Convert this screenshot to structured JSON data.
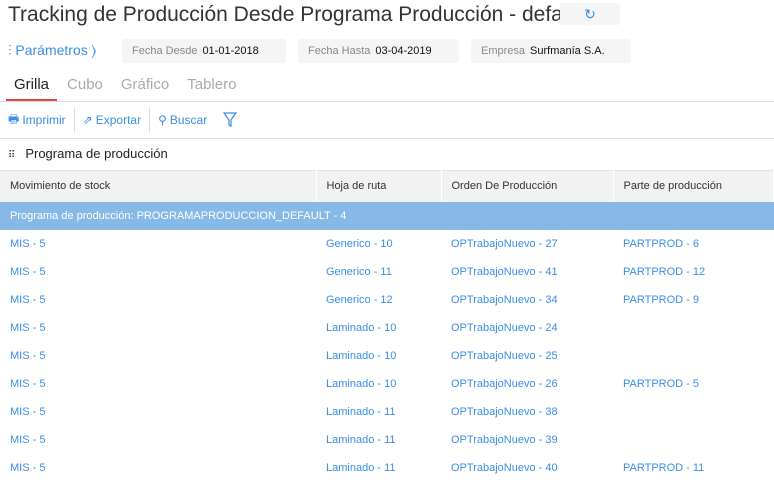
{
  "header": {
    "title": "Tracking de Producción Desde Programa Producción - default",
    "refresh_icon": "↻"
  },
  "params": {
    "label": "Parámetros ⟩",
    "filters": [
      {
        "label": "Fecha Desde",
        "value": "01-01-2018"
      },
      {
        "label": "Fecha Hasta",
        "value": "03-04-2019"
      },
      {
        "label": "Empresa",
        "value": "Surfmanía S.A."
      }
    ]
  },
  "tabs": [
    "Grilla",
    "Cubo",
    "Gráfico",
    "Tablero"
  ],
  "toolbar": {
    "print": "Imprimir",
    "export": "Exportar",
    "search": "Buscar"
  },
  "section": {
    "title": "Programa de producción"
  },
  "table": {
    "columns": [
      "Movimiento de stock",
      "Hoja de ruta",
      "Orden De Producción",
      "Parte de producción"
    ],
    "group": "Programa de producción: PROGRAMAPRODUCCION_DEFAULT - 4",
    "rows": [
      [
        "MIS - 5",
        "Generico - 10",
        "OPTrabajoNuevo - 27",
        "PARTPROD - 6"
      ],
      [
        "MIS - 5",
        "Generico - 11",
        "OPTrabajoNuevo - 41",
        "PARTPROD - 12"
      ],
      [
        "MIS - 5",
        "Generico - 12",
        "OPTrabajoNuevo - 34",
        "PARTPROD - 9"
      ],
      [
        "MIS - 5",
        "Laminado - 10",
        "OPTrabajoNuevo - 24",
        ""
      ],
      [
        "MIS - 5",
        "Laminado - 10",
        "OPTrabajoNuevo - 25",
        ""
      ],
      [
        "MIS - 5",
        "Laminado - 10",
        "OPTrabajoNuevo - 26",
        "PARTPROD - 5"
      ],
      [
        "MIS - 5",
        "Laminado - 11",
        "OPTrabajoNuevo - 38",
        ""
      ],
      [
        "MIS - 5",
        "Laminado - 11",
        "OPTrabajoNuevo - 39",
        ""
      ],
      [
        "MIS - 5",
        "Laminado - 11",
        "OPTrabajoNuevo - 40",
        "PARTPROD - 11"
      ]
    ]
  }
}
